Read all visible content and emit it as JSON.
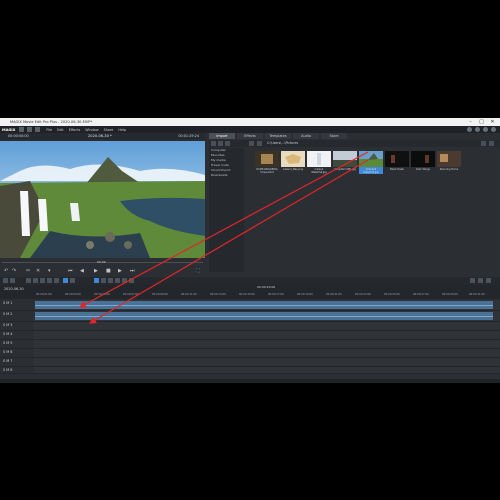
{
  "window": {
    "title": "MAGIX Movie Edit Pro Plus - 2020-06-30.MVP*",
    "controls": [
      "–",
      "□",
      "✕"
    ]
  },
  "menu": {
    "logo": "MAGIX",
    "items": [
      "File",
      "Edit",
      "Effects",
      "Window",
      "Share",
      "Help"
    ]
  },
  "preview": {
    "timecode": "00:00:00:00",
    "project_title": "2020-06-30 *",
    "duration": "00:01:29:24",
    "scrub_label": "00:00"
  },
  "media_pool": {
    "tabs": [
      "Import",
      "Effects",
      "Templates",
      "Audio",
      "Store"
    ],
    "active_tab": "Import",
    "path": "C:\\Users\\...\\Pictures",
    "folders": [
      "Computer",
      "Favorites",
      "My media",
      "Travel route",
      "Cloud Import",
      "Downloads"
    ],
    "items": [
      {
        "caption": "DCIM\\100GOPRO\\ Screenshot",
        "kind": "folder"
      },
      {
        "caption": "Iceland_Map.png",
        "kind": "map"
      },
      {
        "caption": "Iceland Waterfall.jpg",
        "kind": "waterfall"
      },
      {
        "caption": "Kirkjufell Cliffs.jpg",
        "kind": "landscape"
      },
      {
        "caption": "Kirkjufell Waterfall.jpg",
        "kind": "waterfall",
        "selected": true
      },
      {
        "caption": "Black Hawk",
        "kind": "dark"
      },
      {
        "caption": "Dark Wings",
        "kind": "dark"
      },
      {
        "caption": "Standing Home",
        "kind": "room"
      }
    ]
  },
  "timeline": {
    "timecode": "2020-06-30",
    "center_label": "00:00:20:00",
    "ticks": [
      "00:00:01:00",
      "00:00:03:00",
      "00:00:05:00",
      "00:00:07:00",
      "00:00:09:00",
      "00:00:11:00",
      "00:00:13:00",
      "00:00:15:00",
      "00:00:17:00",
      "00:00:19:00",
      "00:00:21:00",
      "00:00:23:00",
      "00:00:25:00",
      "00:00:27:00",
      "00:00:29:00",
      "00:00:31:00"
    ],
    "tracks": [
      {
        "label": "S M 1"
      },
      {
        "label": "S M 2"
      },
      {
        "label": "S M 3"
      },
      {
        "label": "S M 4"
      },
      {
        "label": "S M 5"
      },
      {
        "label": "S M 6"
      },
      {
        "label": "S M 7"
      },
      {
        "label": "S M 8"
      },
      {
        "label": "S M 9"
      }
    ]
  },
  "colors": {
    "accent": "#3f8ad8",
    "arrow": "#e0262b",
    "clip": "#4a7196"
  }
}
